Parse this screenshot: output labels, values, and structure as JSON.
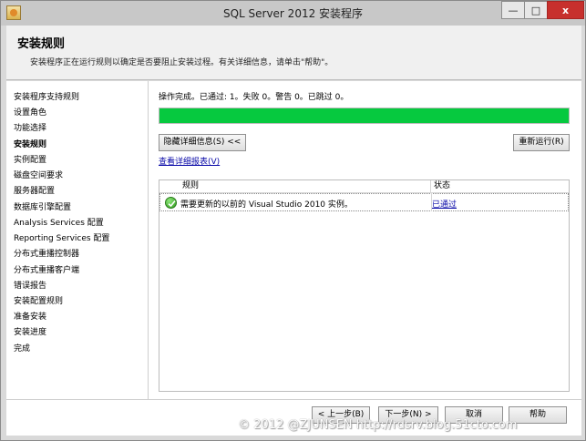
{
  "window": {
    "title": "SQL Server 2012 安装程序",
    "controls": {
      "minimize": "—",
      "maximize": "□",
      "close": "x"
    }
  },
  "header": {
    "title": "安装规则",
    "description": "安装程序正在运行规则以确定是否要阻止安装过程。有关详细信息，请单击\"帮助\"。"
  },
  "sidebar": {
    "items": [
      {
        "label": "安装程序支持规则",
        "active": false
      },
      {
        "label": "设置角色",
        "active": false
      },
      {
        "label": "功能选择",
        "active": false
      },
      {
        "label": "安装规则",
        "active": true
      },
      {
        "label": "实例配置",
        "active": false
      },
      {
        "label": "磁盘空间要求",
        "active": false
      },
      {
        "label": "服务器配置",
        "active": false
      },
      {
        "label": "数据库引擎配置",
        "active": false
      },
      {
        "label": "Analysis Services 配置",
        "active": false
      },
      {
        "label": "Reporting Services 配置",
        "active": false
      },
      {
        "label": "分布式重播控制器",
        "active": false
      },
      {
        "label": "分布式重播客户端",
        "active": false
      },
      {
        "label": "错误报告",
        "active": false
      },
      {
        "label": "安装配置规则",
        "active": false
      },
      {
        "label": "准备安装",
        "active": false
      },
      {
        "label": "安装进度",
        "active": false
      },
      {
        "label": "完成",
        "active": false
      }
    ]
  },
  "main": {
    "status": "操作完成。已通过: 1。失败 0。警告 0。已跳过 0。",
    "progress_percent": 100,
    "progress_color": "#06c93f",
    "hide_details_label": "隐藏详细信息(S) <<",
    "rerun_label": "重新运行(R)",
    "view_report_label": "查看详细报表(V)",
    "table": {
      "columns": [
        "规则",
        "状态"
      ],
      "rows": [
        {
          "icon": "check-icon",
          "rule": "需要更新的以前的 Visual Studio 2010 实例。",
          "status": "已通过"
        }
      ]
    }
  },
  "footer": {
    "back_label": "< 上一步(B)",
    "next_label": "下一步(N) >",
    "cancel_label": "取消",
    "help_label": "帮助"
  },
  "watermark": "© 2012 @ZJUNSEN http://rdsrv.blog.51cto.com"
}
